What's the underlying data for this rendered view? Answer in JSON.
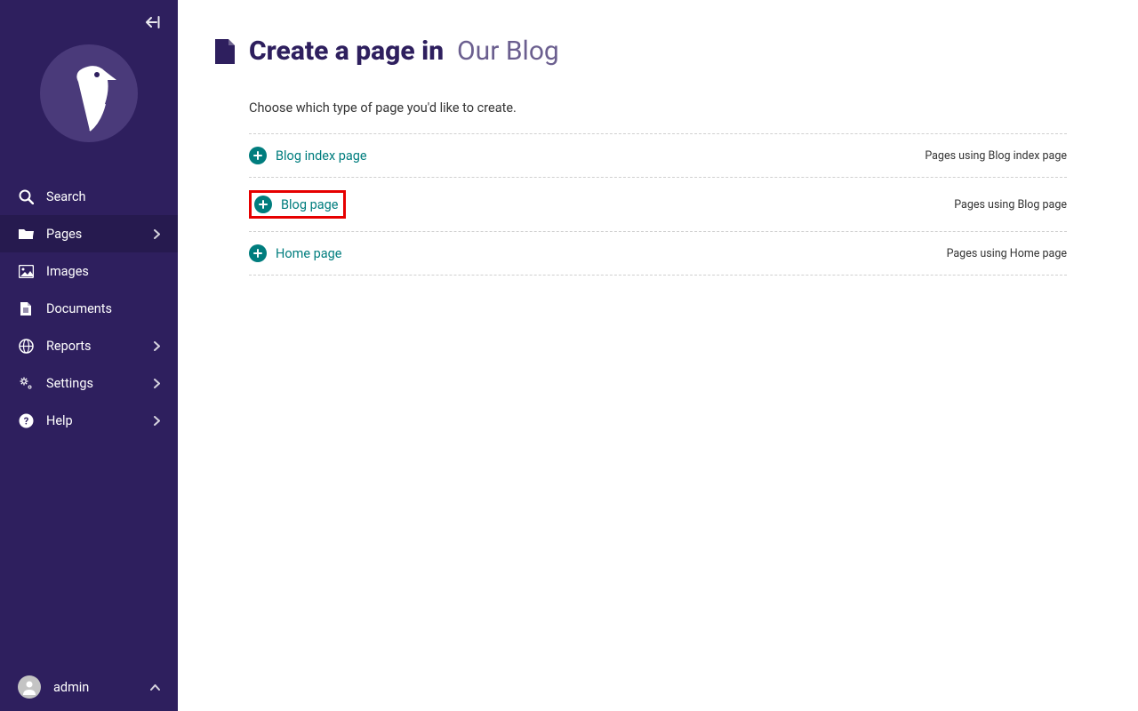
{
  "sidebar": {
    "items": [
      {
        "label": "Search",
        "icon": "search",
        "chevron": false
      },
      {
        "label": "Pages",
        "icon": "folder",
        "chevron": true,
        "active": true
      },
      {
        "label": "Images",
        "icon": "image",
        "chevron": false
      },
      {
        "label": "Documents",
        "icon": "document",
        "chevron": false
      },
      {
        "label": "Reports",
        "icon": "globe",
        "chevron": true
      },
      {
        "label": "Settings",
        "icon": "cogs",
        "chevron": true
      },
      {
        "label": "Help",
        "icon": "help",
        "chevron": true
      }
    ],
    "user": "admin"
  },
  "header": {
    "title_bold": "Create a page in",
    "title_light": "Our Blog"
  },
  "subheading": "Choose which type of page you'd like to create.",
  "page_types": [
    {
      "name": "Blog index page",
      "desc": "Pages using Blog index page",
      "highlighted": false
    },
    {
      "name": "Blog page",
      "desc": "Pages using Blog page",
      "highlighted": true
    },
    {
      "name": "Home page",
      "desc": "Pages using Home page",
      "highlighted": false
    }
  ]
}
